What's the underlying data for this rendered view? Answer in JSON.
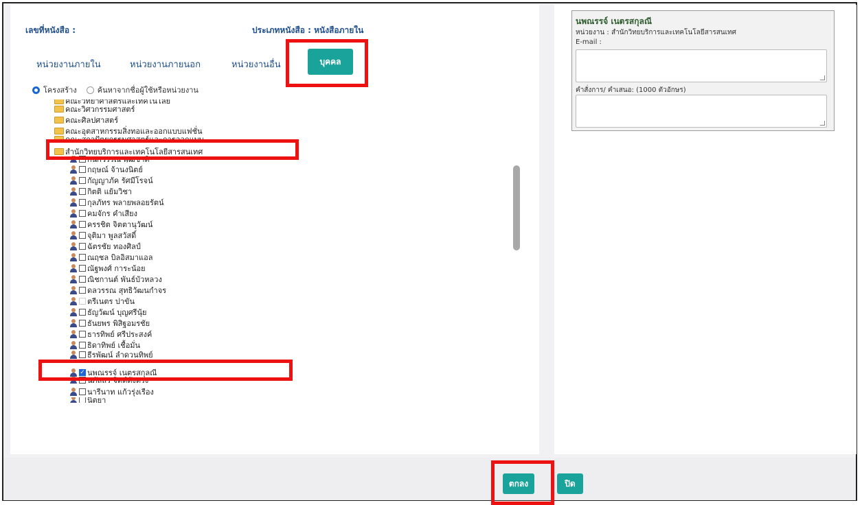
{
  "header": {
    "doc_number_label": "เลขที่หนังสือ :",
    "doc_type_label": "ประเภทหนังสือ : หนังสือภายใน"
  },
  "tabs": [
    {
      "label": "หน่วยงานภายใน"
    },
    {
      "label": "หน่วยงานภายนอก"
    },
    {
      "label": "หน่วยงานอื่น"
    },
    {
      "label": "บุคคล",
      "active": true
    }
  ],
  "search_mode": {
    "option_structure": "โครงสร้าง",
    "option_search": "ค้นหาจากชื่อผู้ใช้หรือหน่วยงาน",
    "selected": "โครงสร้าง"
  },
  "tree": {
    "folders": [
      {
        "label": "คณะวิทยาศาสตร์และเทคโนโลยี"
      },
      {
        "label": "คณะวิศวกรรมศาสตร์"
      },
      {
        "label": "คณะศิลปศาสตร์"
      },
      {
        "label": "คณะอุตสาหกรรมสิ่งทอและออกแบบแฟชั่น"
      },
      {
        "label": "คณะสถาปัตยกรรมศาสตร์และการออกแบบ"
      },
      {
        "label": "สำนักวิทยบริการและเทคโนโลยีสารสนเทศ",
        "expanded": true
      }
    ],
    "people": [
      {
        "label": "กนกวรรณ พุฒชาติ",
        "checked": false
      },
      {
        "label": "กฤษณ์ จ้านงนิตย์",
        "checked": false
      },
      {
        "label": "กัญญาภัค รัศมีโรจน์",
        "checked": false
      },
      {
        "label": "กิตติ แย้มวิชา",
        "checked": false
      },
      {
        "label": "กุลภัทร พลายพลอยรัตน์",
        "checked": false
      },
      {
        "label": "คมจักร คำเสียง",
        "checked": false
      },
      {
        "label": "ครรชิต จิตตานุวัฒน์",
        "checked": false
      },
      {
        "label": "จุติมา พูลสวัสดิ์",
        "checked": false
      },
      {
        "label": "ฉัตรชัย ทองศิลป์",
        "checked": false
      },
      {
        "label": "ณฤชล บิลอิสมาแอล",
        "checked": false
      },
      {
        "label": "ณัฐพงศ์ การะน้อย",
        "checked": false
      },
      {
        "label": "ณิชกานต์ พันธ์บัวหลวง",
        "checked": false
      },
      {
        "label": "ดลวรรณ สุทธิวัฒนกำจร",
        "checked": false
      },
      {
        "label": "ตรีเนตร ปาขัน",
        "checked": false,
        "disabled": true
      },
      {
        "label": "ธัญวัฒน์ บุญศรีนุ้ย",
        "checked": false
      },
      {
        "label": "ธันยพร พิสิฐอมรชัย",
        "checked": false
      },
      {
        "label": "ธารทิพย์ ศรีประสงค์",
        "checked": false
      },
      {
        "label": "ธิดาทิพย์ เชื้อมั่น",
        "checked": false
      },
      {
        "label": "ธีรพัฒน์ ลำดวนทิพย์",
        "checked": false
      },
      {
        "label": "นพณรรจ์ เนตรสกุลณี",
        "checked": true
      },
      {
        "label": "นภัสสร จิตต์ตั้งตรง",
        "checked": false
      },
      {
        "label": "นารีนาท แก้วรุ่งเรือง",
        "checked": false
      },
      {
        "label": "นิตยา",
        "checked": false
      }
    ]
  },
  "selected_person": {
    "name": "นพณรรจ์ เนตรสกุลณี",
    "unit_line": "หน่วยงาน : สำนักวิทยบริการและเทคโนโลยีสารสนเทศ",
    "email_label": "E-mail :",
    "email_value": "",
    "instruction_label": "คำสั่งการ/ คำเสนอ: (1000 ตัวอักษร)",
    "instruction_value": ""
  },
  "footer": {
    "ok_label": "ตกลง",
    "close_label": "ปิด"
  },
  "colors": {
    "accent": "#1aa39a",
    "highlight": "#ee1111",
    "label_blue": "#1f4f8c"
  }
}
